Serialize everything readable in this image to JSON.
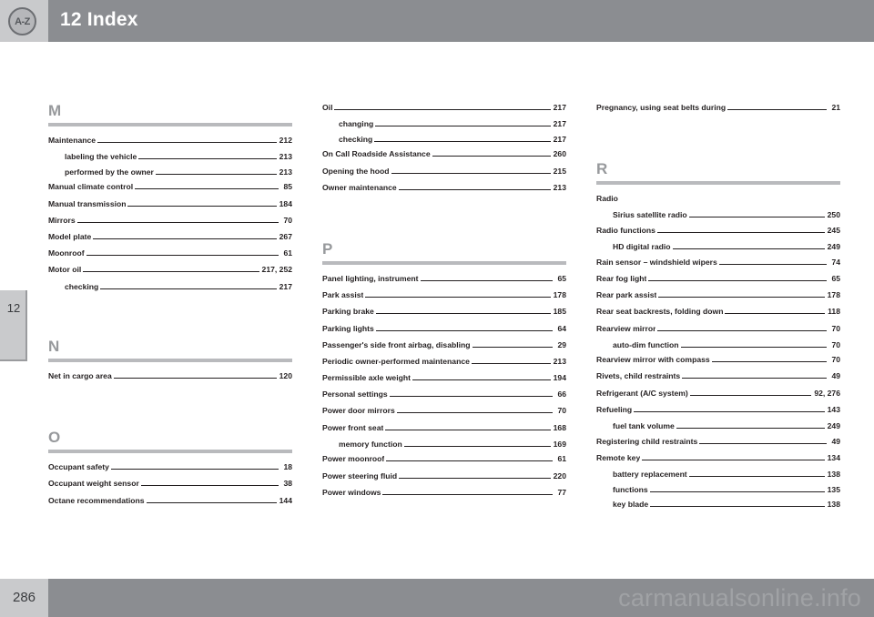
{
  "header": {
    "icon": "a-z-index-icon",
    "icon_text": "A-Z",
    "title": "12 Index"
  },
  "chapter_tab": {
    "number": "12"
  },
  "footer": {
    "page_number": "286",
    "watermark": "carmanualsonline.info"
  },
  "columns": [
    {
      "id": "column-1",
      "blocks": [
        {
          "letter": "M",
          "entries": [
            {
              "label": "Maintenance",
              "page": "212",
              "sub": false
            },
            {
              "label": "labeling the vehicle",
              "page": "213",
              "sub": true
            },
            {
              "label": "performed by the owner",
              "page": "213",
              "sub": true
            },
            {
              "label": "Manual climate control",
              "page": "85",
              "sub": false
            },
            {
              "label": "Manual transmission",
              "page": "184",
              "sub": false
            },
            {
              "label": "Mirrors",
              "page": "70",
              "sub": false
            },
            {
              "label": "Model plate",
              "page": "267",
              "sub": false
            },
            {
              "label": "Moonroof",
              "page": "61",
              "sub": false
            },
            {
              "label": "Motor oil",
              "page": "217, 252",
              "sub": false
            },
            {
              "label": "checking",
              "page": "217",
              "sub": true
            }
          ]
        },
        {
          "letter": "N",
          "entries": [
            {
              "label": "Net in cargo area",
              "page": "120",
              "sub": false
            }
          ]
        },
        {
          "letter": "O",
          "entries": [
            {
              "label": "Occupant safety",
              "page": "18",
              "sub": false
            },
            {
              "label": "Occupant weight sensor",
              "page": "38",
              "sub": false
            },
            {
              "label": "Octane recommendations",
              "page": "144",
              "sub": false
            }
          ]
        }
      ]
    },
    {
      "id": "column-2",
      "blocks": [
        {
          "letter": "",
          "entries": [
            {
              "label": "Oil",
              "page": "217",
              "sub": false
            },
            {
              "label": "changing",
              "page": "217",
              "sub": true
            },
            {
              "label": "checking",
              "page": "217",
              "sub": true
            },
            {
              "label": "On Call Roadside Assistance",
              "page": "260",
              "sub": false
            },
            {
              "label": "Opening the hood",
              "page": "215",
              "sub": false
            },
            {
              "label": "Owner maintenance",
              "page": "213",
              "sub": false
            }
          ]
        },
        {
          "letter": "P",
          "entries": [
            {
              "label": "Panel lighting, instrument",
              "page": "65",
              "sub": false
            },
            {
              "label": "Park assist",
              "page": "178",
              "sub": false
            },
            {
              "label": "Parking brake",
              "page": "185",
              "sub": false
            },
            {
              "label": "Parking lights",
              "page": "64",
              "sub": false
            },
            {
              "label": "Passenger's side front airbag, disabling",
              "page": "29",
              "sub": false
            },
            {
              "label": "Periodic owner-performed maintenance",
              "page": "213",
              "sub": false
            },
            {
              "label": "Permissible axle weight",
              "page": "194",
              "sub": false
            },
            {
              "label": "Personal settings",
              "page": "66",
              "sub": false
            },
            {
              "label": "Power door mirrors",
              "page": "70",
              "sub": false
            },
            {
              "label": "Power front seat",
              "page": "168",
              "sub": false
            },
            {
              "label": "memory function",
              "page": "169",
              "sub": true
            },
            {
              "label": "Power moonroof",
              "page": "61",
              "sub": false
            },
            {
              "label": "Power steering fluid",
              "page": "220",
              "sub": false
            },
            {
              "label": "Power windows",
              "page": "77",
              "sub": false
            }
          ]
        }
      ]
    },
    {
      "id": "column-3",
      "blocks": [
        {
          "letter": "",
          "entries": [
            {
              "label": "Pregnancy, using seat belts during",
              "page": "21",
              "sub": false
            }
          ]
        },
        {
          "letter": "R",
          "entries": [
            {
              "label": "Radio",
              "page": "",
              "sub": false,
              "nodots": true
            },
            {
              "label": "Sirius satellite radio",
              "page": "250",
              "sub": true
            },
            {
              "label": "Radio functions",
              "page": "245",
              "sub": false
            },
            {
              "label": "HD digital radio",
              "page": "249",
              "sub": true
            },
            {
              "label": "Rain sensor – windshield wipers",
              "page": "74",
              "sub": false
            },
            {
              "label": "Rear fog light",
              "page": "65",
              "sub": false
            },
            {
              "label": "Rear park assist",
              "page": "178",
              "sub": false
            },
            {
              "label": "Rear seat backrests, folding down",
              "page": "118",
              "sub": false
            },
            {
              "label": "Rearview mirror",
              "page": "70",
              "sub": false
            },
            {
              "label": "auto-dim function",
              "page": "70",
              "sub": true
            },
            {
              "label": "Rearview mirror with compass",
              "page": "70",
              "sub": false
            },
            {
              "label": "Rivets, child restraints",
              "page": "49",
              "sub": false
            },
            {
              "label": "Refrigerant (A/C system)",
              "page": "92, 276",
              "sub": false
            },
            {
              "label": "Refueling",
              "page": "143",
              "sub": false
            },
            {
              "label": "fuel tank volume",
              "page": "249",
              "sub": true
            },
            {
              "label": "Registering child restraints",
              "page": "49",
              "sub": false
            },
            {
              "label": "Remote key",
              "page": "134",
              "sub": false
            },
            {
              "label": "battery replacement",
              "page": "138",
              "sub": true
            },
            {
              "label": "functions",
              "page": "135",
              "sub": true
            },
            {
              "label": "key blade",
              "page": "138",
              "sub": true
            }
          ]
        }
      ]
    }
  ]
}
